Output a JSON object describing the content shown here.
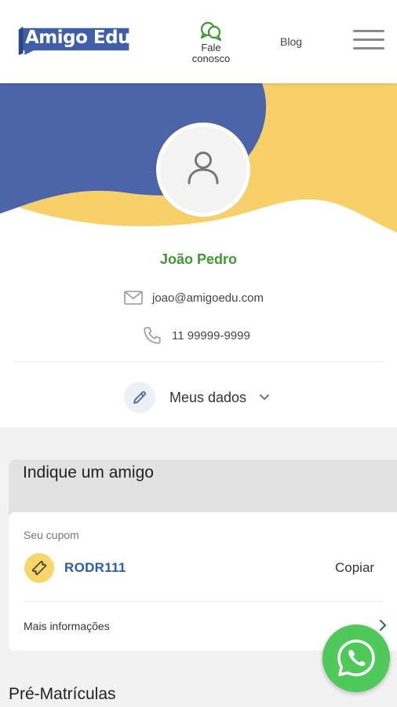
{
  "header": {
    "logo_text": "Amigo Edu",
    "contact_label_line1": "Fale",
    "contact_label_line2": "conosco",
    "blog_label": "Blog",
    "menu_icon": "hamburger-icon"
  },
  "profile": {
    "name": "João Pedro",
    "email": "joao@amigoedu.com",
    "phone": "11 99999-9999",
    "my_data_label": "Meus dados",
    "avatar_icon": "user-icon",
    "colors": {
      "blue": "#4b65a8",
      "yellow": "#f7d06a",
      "name_green": "#3d9a2e"
    }
  },
  "referral": {
    "title": "Indique um amigo",
    "coupon_label": "Seu cupom",
    "coupon_code": "RODR111",
    "copy_label": "Copiar",
    "more_info_label": "Mais informações"
  },
  "pre_enrollments": {
    "title": "Pré-Matrículas"
  },
  "floating": {
    "whatsapp_icon": "whatsapp-icon",
    "color": "#4fc95a"
  }
}
